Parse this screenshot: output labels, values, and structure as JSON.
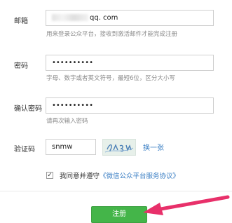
{
  "form": {
    "email": {
      "label": "邮箱",
      "value_visible": "qq. com",
      "hint": "用来登录公众平台，接收到激活邮件才能完成注册"
    },
    "password": {
      "label": "密码",
      "value": "••••••••••",
      "hint": "字母、数字或者英文符号，最短6位，区分大小写"
    },
    "confirm_password": {
      "label": "确认密码",
      "value": "••••••••••",
      "hint": "请再次输入密码"
    },
    "captcha": {
      "label": "验证码",
      "value": "snmw",
      "refresh_label": "换一张"
    },
    "agreement": {
      "checked_mark": "✓",
      "text": "我同意并遵守",
      "link": "《微信公众平台服务协议》"
    },
    "submit_label": "注册"
  },
  "colors": {
    "link": "#3b7fc4",
    "submit_bg": "#44b549",
    "arrow": "#e8306a"
  }
}
